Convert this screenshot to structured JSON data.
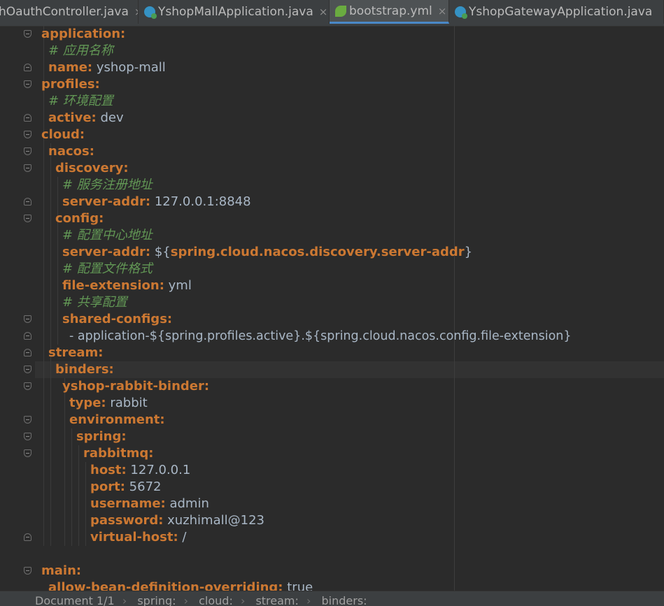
{
  "tabs": [
    {
      "label": "hOauthController.java",
      "icon": "java-class-icon",
      "active": false
    },
    {
      "label": "YshopMallApplication.java",
      "icon": "java-class-icon",
      "active": false
    },
    {
      "label": "bootstrap.yml",
      "icon": "spring-leaf-icon",
      "active": true
    },
    {
      "label": "YshopGatewayApplication.java",
      "icon": "java-class-icon",
      "active": false
    }
  ],
  "close_glyph": "×",
  "code": [
    {
      "key": "application:",
      "value": "",
      "comment": ""
    },
    {
      "key": "",
      "value": "",
      "comment": "# 应用名称"
    },
    {
      "key": "name:",
      "value": " yshop-mall",
      "comment": ""
    },
    {
      "key": "profiles:",
      "value": "",
      "comment": ""
    },
    {
      "key": "",
      "value": "",
      "comment": "# 环境配置"
    },
    {
      "key": "active:",
      "value": " dev",
      "comment": ""
    },
    {
      "key": "cloud:",
      "value": "",
      "comment": ""
    },
    {
      "key": "nacos:",
      "value": "",
      "comment": ""
    },
    {
      "key": "discovery:",
      "value": "",
      "comment": ""
    },
    {
      "key": "",
      "value": "",
      "comment": "# 服务注册地址"
    },
    {
      "key": "server-addr:",
      "value": " 127.0.0.1:8848",
      "comment": ""
    },
    {
      "key": "config:",
      "value": "",
      "comment": ""
    },
    {
      "key": "",
      "value": "",
      "comment": "# 配置中心地址"
    },
    {
      "key": "server-addr:",
      "value": " ${",
      "ref": "spring.cloud.nacos.discovery.server-addr",
      "tail": "}",
      "comment": ""
    },
    {
      "key": "",
      "value": "",
      "comment": "# 配置文件格式"
    },
    {
      "key": "file-extension:",
      "value": " yml",
      "comment": ""
    },
    {
      "key": "",
      "value": "",
      "comment": "# 共享配置"
    },
    {
      "key": "shared-configs:",
      "value": "",
      "comment": ""
    },
    {
      "key": "",
      "value": "- application-${spring.profiles.active}.${spring.cloud.nacos.config.file-extension}",
      "comment": ""
    },
    {
      "key": "stream:",
      "value": "",
      "comment": ""
    },
    {
      "key": "binders:",
      "value": "",
      "comment": ""
    },
    {
      "key": "yshop-rabbit-binder:",
      "value": "",
      "comment": ""
    },
    {
      "key": "type:",
      "value": " rabbit",
      "comment": ""
    },
    {
      "key": "environment:",
      "value": "",
      "comment": ""
    },
    {
      "key": "spring:",
      "value": "",
      "comment": ""
    },
    {
      "key": "rabbitmq:",
      "value": "",
      "comment": ""
    },
    {
      "key": "host:",
      "value": " 127.0.0.1",
      "comment": ""
    },
    {
      "key": "port:",
      "value": " 5672",
      "comment": ""
    },
    {
      "key": "username:",
      "value": " admin",
      "comment": ""
    },
    {
      "key": "password:",
      "value": " xuzhimall@123",
      "comment": ""
    },
    {
      "key": "virtual-host:",
      "value": " /",
      "comment": ""
    },
    {
      "key": "",
      "value": "",
      "comment": ""
    },
    {
      "key": "main:",
      "value": "",
      "comment": ""
    },
    {
      "key": "allow-bean-definition-overriding:",
      "value": " true",
      "comment": ""
    }
  ],
  "breadcrumb": [
    "Document 1/1",
    "spring:",
    "cloud:",
    "stream:",
    "binders:"
  ],
  "breadcrumb_sep": "›",
  "colors": {
    "key": "#cc7832",
    "comment": "#629755",
    "text": "#a9b7c6",
    "background": "#2b2b2b",
    "accent": "#4a88c7"
  }
}
